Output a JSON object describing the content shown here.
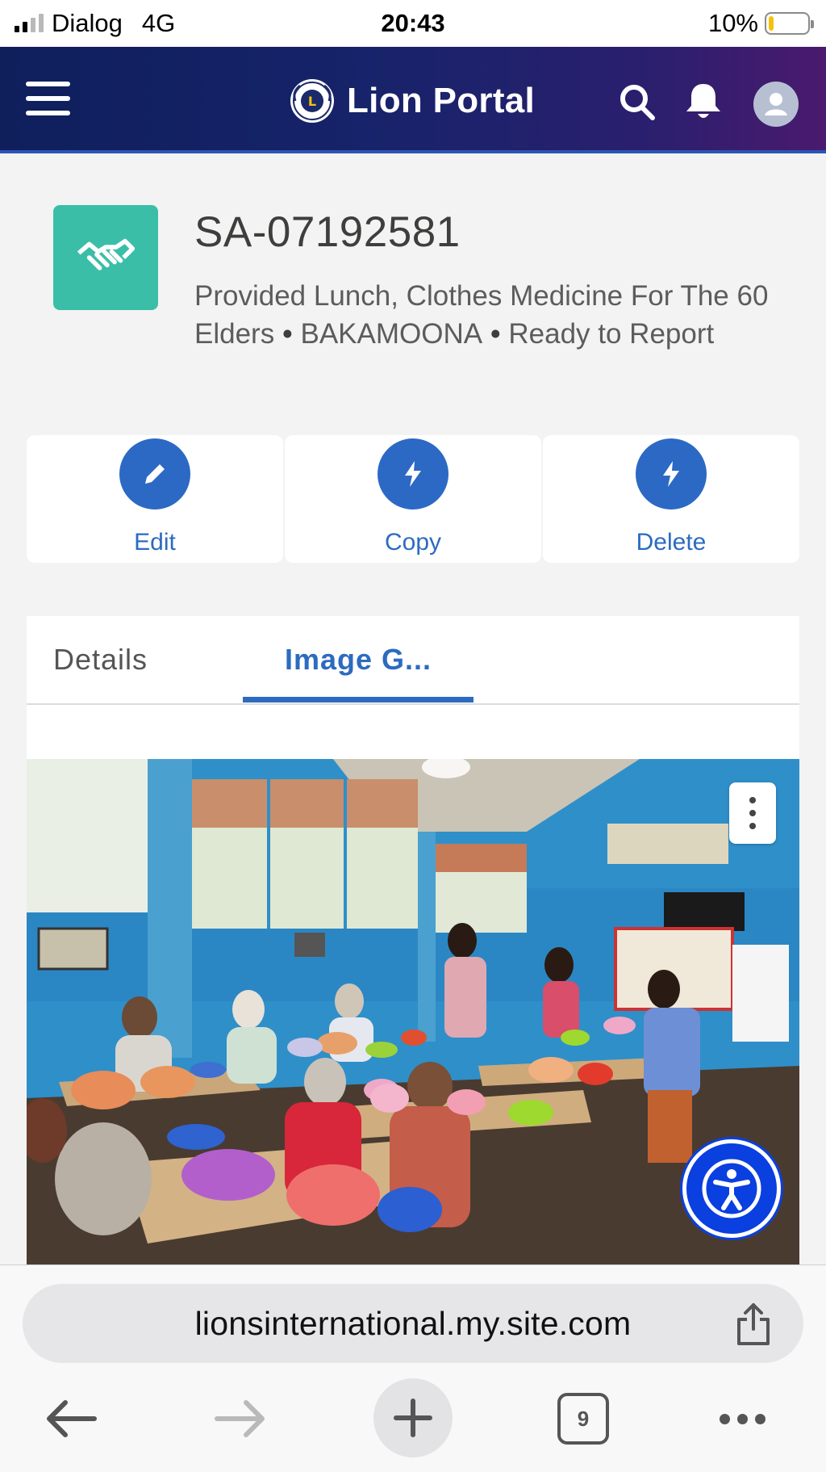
{
  "status_bar": {
    "carrier": "Dialog",
    "network": "4G",
    "time": "20:43",
    "battery": "10%",
    "battery_level": 0.1
  },
  "header": {
    "title": "Lion Portal",
    "menu_icon": "hamburger-menu-icon",
    "logo_icon": "lions-logo-icon",
    "search_icon": "search-icon",
    "notifications_icon": "bell-icon",
    "avatar_icon": "user-avatar-icon"
  },
  "record": {
    "icon": "handshake-icon",
    "id": "SA-07192581",
    "subtitle_part1": "Provided Lunch, Clothes Medicine For The 60 Elders",
    "separator": "•",
    "subtitle_part2": "BAKAMOONA",
    "subtitle_part3": "Ready to Report"
  },
  "actions": {
    "edit": {
      "label": "Edit",
      "icon": "pencil-icon"
    },
    "copy": {
      "label": "Copy",
      "icon": "lightning-icon"
    },
    "delete": {
      "label": "Delete",
      "icon": "lightning-icon"
    }
  },
  "tabs": {
    "details": "Details",
    "gallery": "Image G...",
    "active": "gallery"
  },
  "gallery": {
    "more_icon": "vertical-dots-icon",
    "accessibility_icon": "accessibility-icon"
  },
  "browser": {
    "url": "lionsinternational.my.site.com",
    "share_icon": "share-icon",
    "back_icon": "arrow-left-icon",
    "forward_icon": "arrow-right-icon",
    "new_tab_icon": "plus-icon",
    "tab_count": "9",
    "more_icon": "more-dots-icon"
  },
  "colors": {
    "header_start": "#0f1f5c",
    "header_end": "#4a1a6e",
    "accent_blue": "#2c69c4",
    "record_icon_bg": "#3bbea8",
    "battery_low": "#f4c20d",
    "a11y_blue": "#0a3fe0"
  }
}
